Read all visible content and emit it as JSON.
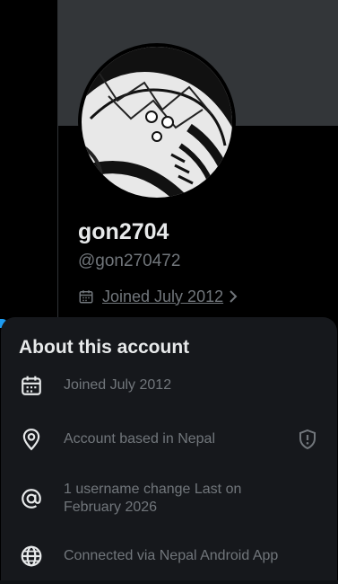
{
  "profile": {
    "display_name": "gon2704",
    "handle": "@gon270472",
    "joined": "Joined July 2012"
  },
  "about": {
    "title": "About this account",
    "items": [
      {
        "icon": "calendar-icon",
        "text": "Joined July 2012"
      },
      {
        "icon": "location-pin-icon",
        "text": "Account based in Nepal"
      },
      {
        "icon": "at-sign-icon",
        "text": "1 username change Last on February 2026"
      },
      {
        "icon": "globe-icon",
        "text": "Connected via Nepal Android App"
      }
    ]
  },
  "colors": {
    "background": "#000000",
    "banner": "#333639",
    "sheet": "#16181c",
    "primary_text": "#e7e9ea",
    "secondary_text": "#71767b",
    "accent": "#1d9bf0"
  }
}
